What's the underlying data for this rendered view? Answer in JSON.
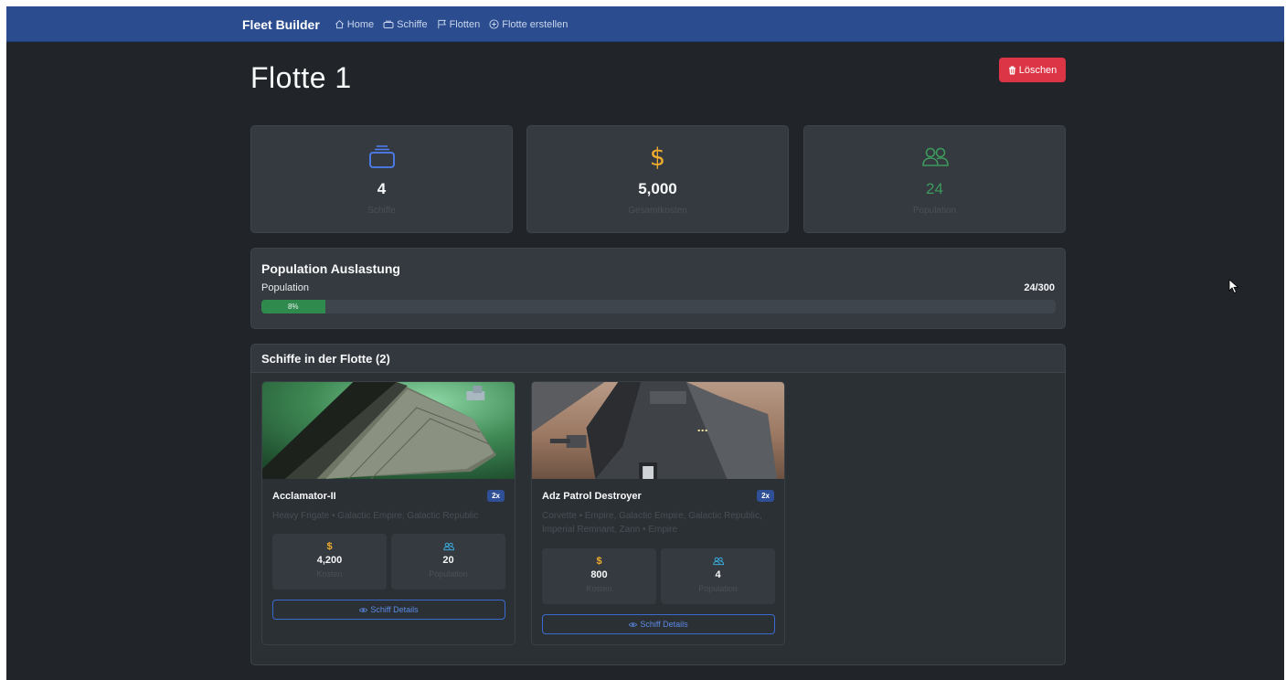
{
  "nav": {
    "brand": "Fleet Builder",
    "links": [
      {
        "label": "Home",
        "icon": "house-icon"
      },
      {
        "label": "Schiffe",
        "icon": "ship-icon"
      },
      {
        "label": "Flotten",
        "icon": "flag-icon"
      },
      {
        "label": "Flotte erstellen",
        "icon": "plus-circle-icon"
      }
    ]
  },
  "page": {
    "title": "Flotte 1",
    "delete_label": "Löschen"
  },
  "stats": [
    {
      "icon": "ship-stack-icon",
      "value": "4",
      "label": "Schiffe",
      "color": "#4d7ff5"
    },
    {
      "icon": "dollar-icon",
      "value": "5,000",
      "label": "Gesamtkosten",
      "color": "#f0ad2d"
    },
    {
      "icon": "people-icon",
      "value": "24",
      "label": "Population",
      "color": "#3d9a5c"
    }
  ],
  "population": {
    "title": "Population Auslastung",
    "label": "Population",
    "count": "24/300",
    "percent_label": "8%",
    "fraction": 0.08
  },
  "fleet": {
    "title": "Schiffe in der Flotte (2)",
    "ships": [
      {
        "name": "Acclamator-II",
        "badge": "2x",
        "description": "Heavy Frigate • Galactic Empire, Galactic Republic",
        "cost_value": "4,200",
        "cost_label": "Kosten",
        "pop_value": "20",
        "pop_label": "Population",
        "details_label": "Schiff Details"
      },
      {
        "name": "Adz Patrol Destroyer",
        "badge": "2x",
        "description": "Corvette • Empire, Galactic Empire, Galactic Republic, Imperial Remnant, Zann • Empire",
        "cost_value": "800",
        "cost_label": "Kosten",
        "pop_value": "4",
        "pop_label": "Population",
        "details_label": "Schiff Details"
      }
    ]
  },
  "colors": {
    "navbar": "#2b4d8f",
    "danger": "#dc3545",
    "progress": "#2f8a4e",
    "badge": "#2f4f96",
    "outline_primary": "#3c6bd0"
  }
}
